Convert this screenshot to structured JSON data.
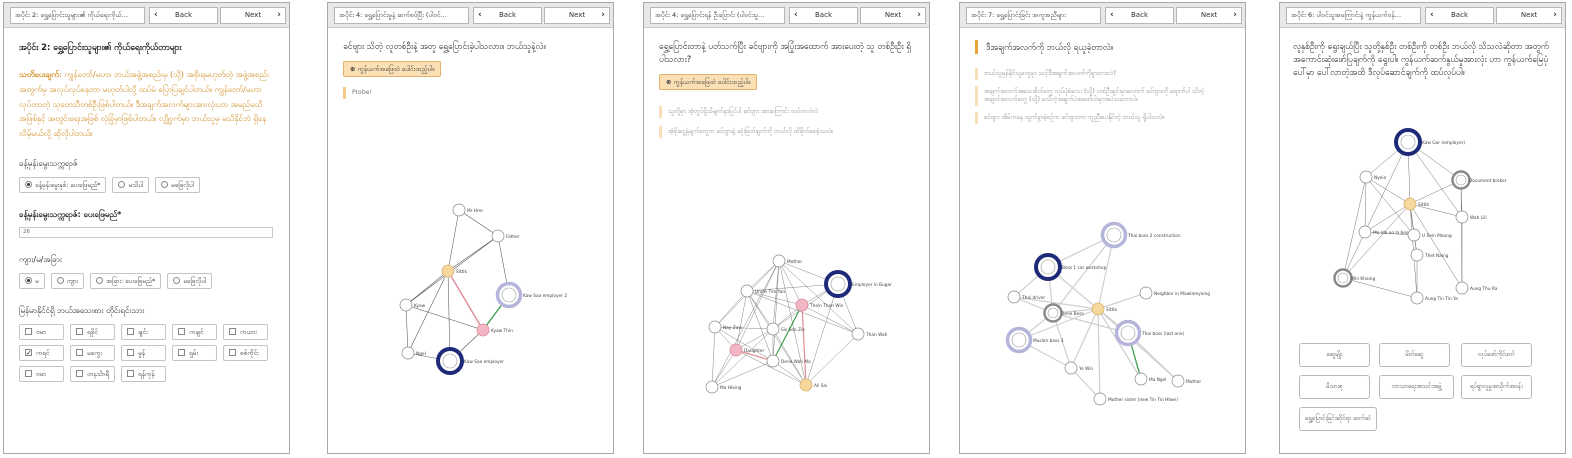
{
  "nav": {
    "back": "Back",
    "next": "Next"
  },
  "panel1": {
    "crumb": "အပိုင်း 2: ရွှေ့ပြောင်းသူများ၏ ကိုယ်ရေးကိုယ်…",
    "title": "အပိုင်း 2: ရွှေ့ပြောင်းသူများ၏ ကိုယ်ရေးကိုယ်တာများ",
    "warn_bold": "သတိပေးချက်",
    "warn_text": ": ကျွန်တော်/မဟာ ဘယ်အဖွဲ့အစည်းမှ (သို့) အစိုးရမဟုတ်တဲ့ အဖွဲ့အစည်းအတွက်မှ အလုပ်လုပ်နေတာ မဟုတ်ပါလို့ ထပ်မံ ပြောပြချင်ပါတယ်။ ကျွန်တော်/မဟာ လုပ်တာတဲ့ သုတေသီတစ်ဦးဖြစ်ပါတယ်။ ဒီအချက်အလက်များအားလုံးဟာ အမည်မသိအဖြစ်နှင့် အတွင်းရေးအဖြစ် လုံခြုံမှာဖြစ်ပါတယ်။ လျှို့ဝှက်မှာ ဘယ်သူမှ မသိနိုင်ဘဲ ရှိနေလိမ့်မယ်လို့ ဆိုလိုပါတယ်။",
    "q_birth": "ခန့်မှန်းမွေးသက္ကရာဇ်",
    "birth_opts": [
      "ခန့်မှန်းမွေးနှစ်: ပေးဖြေမည်*",
      "မသိပါ",
      "မဖြေလိုပါ"
    ],
    "q_age": "ခန့်မှန်းမွေးသက္ကရာဇ်: ပေးဖြေမည်*",
    "age_value": "26",
    "q_gender": "ကျား/မ/အခြား",
    "gender_opts": [
      "မ",
      "ကျား",
      "အခြား: ပေးဖြေမည်*",
      "မဖြေလိုပါ"
    ],
    "q_ethnic": "မြန်မာနိုင်ငံရှိ ဘယ်အသေးစား တိုင်းရင်းသား",
    "ethnic_opts": [
      "ဗမာ",
      "ရခိုင်",
      "ချင်း",
      "ကချင်",
      "ကယား",
      "ကရင်",
      "မကွေး",
      "မွန်",
      "ရှမ်း",
      "စစ်ကိုင်း",
      "ဗမာ",
      "တနင်္သာရီ",
      "ရန်ကုန်"
    ],
    "ethnic_checked_index": 5
  },
  "panel2": {
    "crumb": "အပိုင်း 4: ရွှေ့ပြောင်းမှုနဲ့ ဆက်စပ်ပြီး (ပါဝင်…",
    "question": "ခင်ဗျား သိတဲ့ လူတစ်ဦးနဲ့ အတူ ရွှေ့ပြောင်းခဲ့ပါသလား။ ဘယ်သူနဲ့လဲ။",
    "add_label": "ကွန်ယက်အဖြေထဲ ပေါင်းထည့်ပါ။",
    "probe": "Probe!",
    "nodes": [
      "Mr Hrer",
      "Father",
      "Sittik",
      "Kyaw",
      "Kyaw Thin",
      "Ngel",
      "Kaw Saa employer 2",
      "Kaw Saa employer"
    ]
  },
  "panel3": {
    "crumb": "အပိုင်း 4: ရွှေ့ပြောင်းရန် ဦးပြောင်း (ပါဝင်သူ…",
    "question": "ရွှေ့ပြောင်းတာနဲ့ ပတ်သက်ပြီး ခင်ဗျားကို အပြုံးအထောက် အားပေးတဲ့ သူ တစ်ဦးဦး ရှိပါသလား?",
    "add_label": "ကွန်ယက်အဖြေထဲ ပေါင်းထည့်ပါ။",
    "notes": [
      "သူတို့မှာ အံ့တွင်ရှိသိမျက်နှာပြင်ပါ ခင်ဗျား အားကြောင်း ထပ်တလဲလဲ",
      "အံ့ဖိုးငွေနဲ့မျက်တွေက ခင်ဗျားနဲ့ ဆုံးဖြတ်ချက်ကို ဘယ်လို ထိခိုက်စေခဲ့သလဲ။"
    ],
    "nodes": [
      "Mother",
      "Uncle Tim Yan",
      "Employer in Bugar",
      "Nay Zaw",
      "Sis Son Zie",
      "Thein Than Win",
      "Daughter",
      "Than Wah",
      "Ma Hlaing",
      "Ali Sai",
      "Dene Wah Mo"
    ]
  },
  "panel4": {
    "crumb": "အပိုင်း 7: ရွှေ့ပြောင်းခြင်း အကူအညီများ",
    "section": "ဒီအချက်အလက်ကို ဘယ်လို ရယူခဲ့တာလဲ။",
    "notes": [
      "ဘယ်သူမှန်နိုင်သူတွေမှာ သင့်ဒီအချက်အလက်ကိုရှာထားလဲ?",
      "အချက်အလက်အသေးစိတ်တွေ လုပ်ပုံစံလေး (သို့) တစ်ဦးချင်းမှာလောက် ခင်ဗျားကို ရောက်ပါ သိတဲ့ အချက်အလက်တွေ (သို့) မသိတဲ့အချက်ပဲအဖော်ပါးမှာအပဲသဘောပါ။",
      "ခင်ဗျား အိမ်ကနေ ထွက်ခွာခဲ့စဉ်က ခင်ဗျားဘာ ကူညီပေးနိုင်တဲ့ ဘယ်သူ ရှိပါသလဲ။"
    ],
    "nodes": [
      "Thai boss 2 construction",
      "Boss 1 car workshop",
      "Thai driver",
      "Dene Boss",
      "Sittik",
      "Neighbor in Mawlamyaing",
      "Muslim boss 3",
      "Thai boss (last one)",
      "Ye Win",
      "Ma Ngel",
      "Mother",
      "Mother sister (new Tin Tin Htwe)"
    ]
  },
  "panel5": {
    "crumb": "အပိုင်း 6: ပါဝင်သူအကြောင်းနဲ့ ကွန်ယက်ဝန်…",
    "question": "လူနှစ်ဦးကို ရွေးချယ်ပြီး သူတို့နှစ်ဦး တစ်ဦးကို တစ်ဦး ဘယ်လို သိသလဲဆိုတာ အတွက် အကောင်းဆုံးဖော်ပြချက်ကို ရွေးပါ။ ကွန်ယက်ဆက်နွယ်မှုအားလုံး ဟာ ကွန်ယက်မြေပုံပေါ်မှာ ပေါ်လာတဲ့အထိ ဒီလုပ်ဆောင်ချက်ကို ထပ်လုပ်ပါ။",
    "nodes": [
      "Kaw Gar (employer)",
      "Nyein",
      "Document broker",
      "Sittik",
      "Ma Ide oo la beo",
      "U Sein Maung",
      "Wah Lili",
      "Thet Naing",
      "Aung Thu Ra",
      "Win Khaing",
      "Aung Tin Tin Ya"
    ],
    "buttons": [
      "ဆွေမျိုး",
      "မိတ်ဆွေ",
      "လုပ်ဖော်ကိုင်ဖက်",
      "မိသားစု",
      "ဘာသာရေးအသင်းအဖွဲ့",
      "ရပ်ရွာလူမှုအသိုက်အဝန်း",
      "ရွှေ့ပြောင်းခြင်းဆိုင်ရာ ဆက်ဆံ"
    ]
  }
}
